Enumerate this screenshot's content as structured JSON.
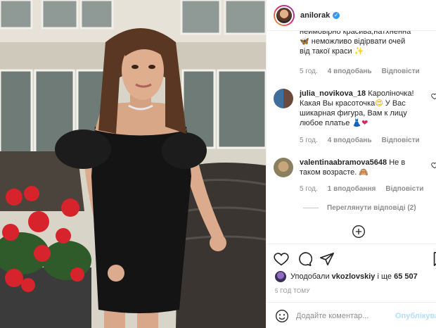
{
  "post": {
    "username": "anilorak",
    "verified_glyph": "✓"
  },
  "caption_tail": {
    "line1": "неймовірно красива,натхненна",
    "line2": "неможливо відірвати очей",
    "line3": "від такої краси",
    "meta": {
      "time": "5 год.",
      "likes": "4 вподобань",
      "reply": "Відповісти"
    }
  },
  "comments": [
    {
      "username": "julia_novikova_18",
      "line1_text": "Кароліночка!",
      "line2": "Какая Вы красоточка",
      "line3": "У Вас",
      "line4": "шикарная фигура, Вам к лицу",
      "line5": "любое платье",
      "meta": {
        "time": "5 год.",
        "likes": "4 вподобань",
        "reply": "Відповісти"
      }
    },
    {
      "username": "valentinaabramova5648",
      "line1_text": "Не в",
      "line2": "таком возрасте.",
      "meta": {
        "time": "5 год.",
        "likes": "1 вподобання",
        "reply": "Відповісти"
      }
    }
  ],
  "view_replies": "Переглянути відповіді (2)",
  "likes": {
    "prefix": "Уподобали",
    "user": "vkozlovskiy",
    "middle": "і ще",
    "count": "65 507"
  },
  "time_ago": "5 ГОД ТОМУ",
  "add_comment": {
    "placeholder": "Додайте коментар...",
    "publish": "Опублікува"
  },
  "colors": {
    "accent": "#3897f0",
    "muted": "#8e8e8e",
    "text": "#262626",
    "publish_disabled": "#b2dffc",
    "heart_red": "#ed4956"
  },
  "icons": {
    "like": "heart-icon",
    "comment": "comment-icon",
    "share": "paper-plane-icon",
    "save": "bookmark-icon",
    "load_more": "plus-circle-icon",
    "emoji": "smiley-icon"
  }
}
